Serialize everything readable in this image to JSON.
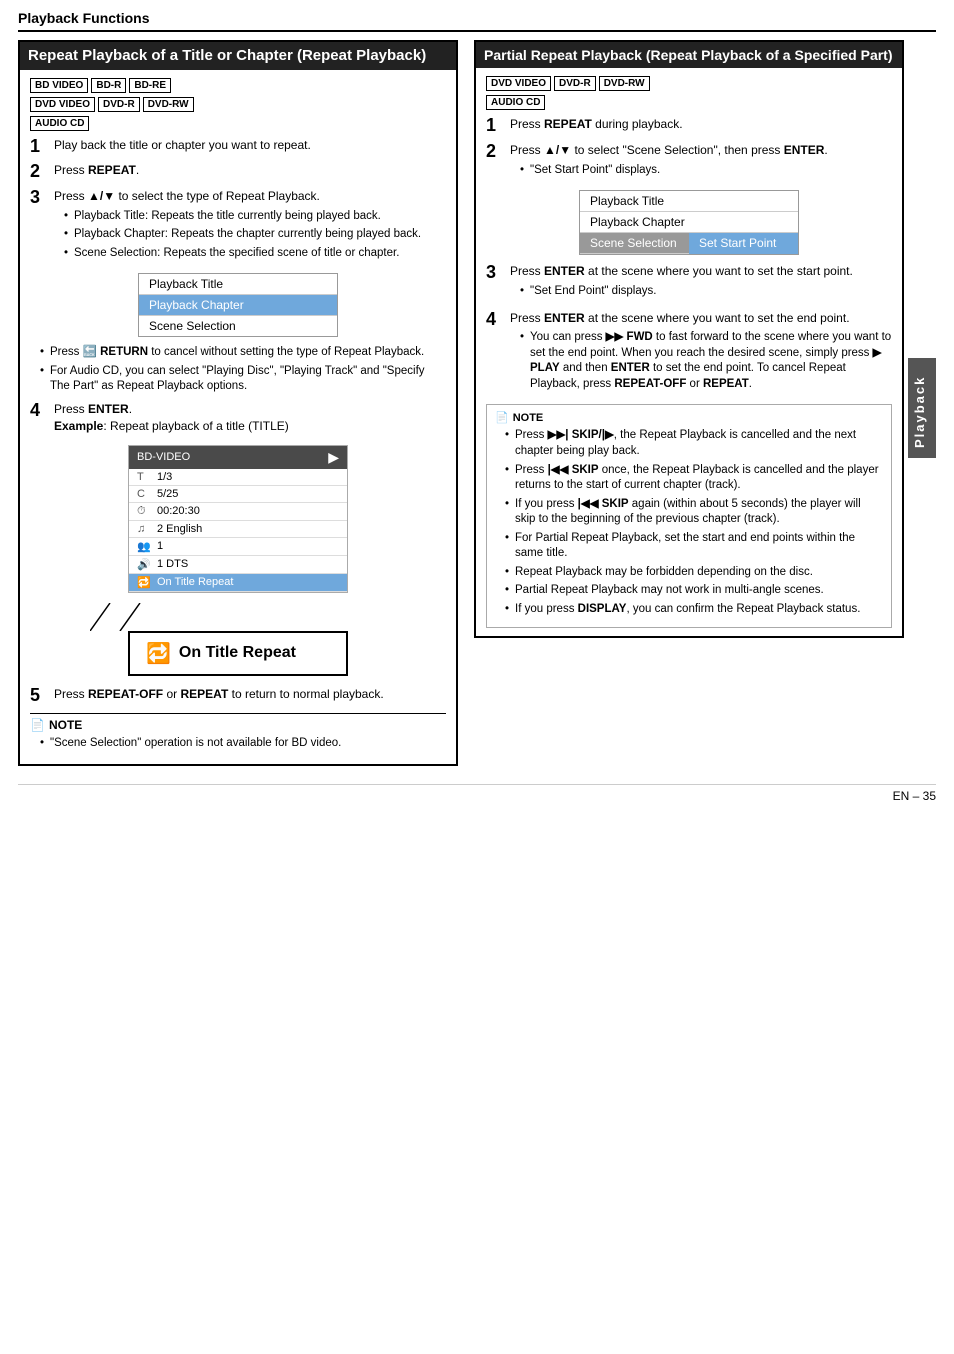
{
  "header": {
    "title": "Playback Functions"
  },
  "left": {
    "section_title": "Repeat Playback of a Title or Chapter (Repeat Playback)",
    "badges_row1": [
      "BD VIDEO",
      "BD-R",
      "BD-RE"
    ],
    "badges_row2": [
      "DVD VIDEO",
      "DVD-R",
      "DVD-RW"
    ],
    "badges_row3": [
      "AUDIO CD"
    ],
    "steps": [
      {
        "num": "1",
        "text": "Play back the title or chapter you want to repeat."
      },
      {
        "num": "2",
        "text": "Press REPEAT."
      },
      {
        "num": "3",
        "text": "Press ▲/▼ to select the type of Repeat Playback.",
        "bullets": [
          "Playback Title: Repeats the title currently being played back.",
          "Playback Chapter: Repeats the chapter currently being played back.",
          "Scene Selection: Repeats the specified scene of title or chapter."
        ]
      }
    ],
    "menu": {
      "items": [
        {
          "label": "Playback Title",
          "highlighted": false
        },
        {
          "label": "Playback Chapter",
          "highlighted": true
        },
        {
          "label": "Scene Selection",
          "highlighted": false
        }
      ]
    },
    "bullets_after_menu": [
      "Press  RETURN to cancel without setting the type of Repeat Playback.",
      "For Audio CD, you can select \"Playing Disc\", \"Playing Track\" and \"Specify The Part\" as Repeat Playback options."
    ],
    "step4": {
      "num": "4",
      "text": "Press ENTER.",
      "sub": "Example: Repeat playback of a title (TITLE)"
    },
    "bd_display": {
      "header": "BD-VIDEO",
      "rows": [
        {
          "icon": "T",
          "value": "1/3"
        },
        {
          "icon": "C",
          "value": "5/25"
        },
        {
          "icon": "⏱",
          "value": "00:20:30"
        },
        {
          "icon": "♫",
          "value": "2 English"
        },
        {
          "icon": "👥",
          "value": "1"
        },
        {
          "icon": "🔊",
          "value": "1 DTS"
        },
        {
          "icon": "🔁",
          "value": "On Title Repeat",
          "highlight": true
        }
      ]
    },
    "repeat_display": {
      "icon": "🔁",
      "label": "On Title Repeat"
    },
    "step5": {
      "num": "5",
      "text": "Press REPEAT-OFF or REPEAT to return to normal playback."
    },
    "note": {
      "title": "NOTE",
      "bullets": [
        "\"Scene Selection\" operation is not available for BD video."
      ]
    }
  },
  "right": {
    "section_title": "Partial Repeat Playback (Repeat Playback of a Specified Part)",
    "badges_row1": [
      "DVD VIDEO",
      "DVD-R",
      "DVD-RW"
    ],
    "badges_row2": [
      "AUDIO CD"
    ],
    "steps": [
      {
        "num": "1",
        "text": "Press REPEAT during playback."
      },
      {
        "num": "2",
        "text": "Press ▲/▼ to select \"Scene Selection\", then press ENTER.",
        "sub": "\"Set Start Point\" displays."
      }
    ],
    "menu": {
      "items": [
        {
          "label": "Playback Title",
          "highlighted": false
        },
        {
          "label": "Playback Chapter",
          "highlighted": false
        },
        {
          "label_left": "Scene Selection",
          "label_right": "Set Start Point",
          "row": true,
          "highlighted": false
        }
      ]
    },
    "steps2": [
      {
        "num": "3",
        "text": "Press ENTER at the scene where you want to set the start point.",
        "sub": "\"Set End Point\" displays."
      },
      {
        "num": "4",
        "text": "Press ENTER at the scene where you want to set the end point.",
        "bullets": [
          "You can press ▶▶ FWD to fast forward to the scene where you want to set the end point. When you reach the desired scene, simply press ▶ PLAY and then ENTER to set the end point. To cancel Repeat Playback, press REPEAT-OFF or REPEAT."
        ]
      }
    ],
    "note": {
      "title": "NOTE",
      "bullets": [
        "Press ▶▶| SKIP/|▶, the Repeat Playback is cancelled and the next chapter being play back.",
        "Press |◀◀ SKIP once, the Repeat Playback is cancelled and the player returns to the start of current chapter (track).",
        "If you press |◀◀ SKIP again (within about 5 seconds) the player will skip to the beginning of the previous chapter (track).",
        "For Partial Repeat Playback, set the start and end points within the same title.",
        "Repeat Playback may be forbidden depending on the disc.",
        "Partial Repeat Playback may not work in multi-angle scenes.",
        "If you press DISPLAY, you can confirm the Repeat Playback status."
      ]
    }
  },
  "sidebar": {
    "label": "Playback"
  },
  "page_number": "EN – 35"
}
